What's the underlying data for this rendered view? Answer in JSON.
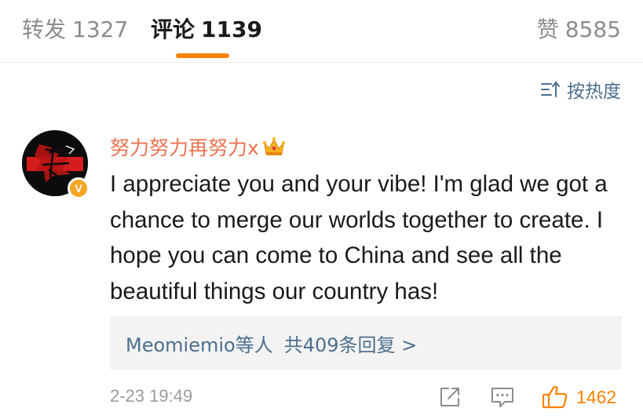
{
  "tabs": {
    "repost": {
      "label": "转发",
      "count": "1327"
    },
    "comment": {
      "label": "评论",
      "count": "1139"
    },
    "like": {
      "label": "赞",
      "count": "8585"
    }
  },
  "sort": {
    "label": "按热度",
    "icon": "sort-icon"
  },
  "comment": {
    "username": "努力努力再努力x",
    "verified_badge": "V",
    "text": "I appreciate you and your vibe! I'm glad we got a chance to merge our worlds together to create. I hope you can come to China and see all the beautiful things our country has!",
    "replies": {
      "users": "Meomiemio等人",
      "count_text": "共409条回复 >"
    },
    "timestamp": "2-23 19:49",
    "like_count": "1462"
  },
  "colors": {
    "accent": "#ff8200",
    "username": "#eb7350",
    "link": "#4d6f8e",
    "badge": "#f5a623"
  }
}
